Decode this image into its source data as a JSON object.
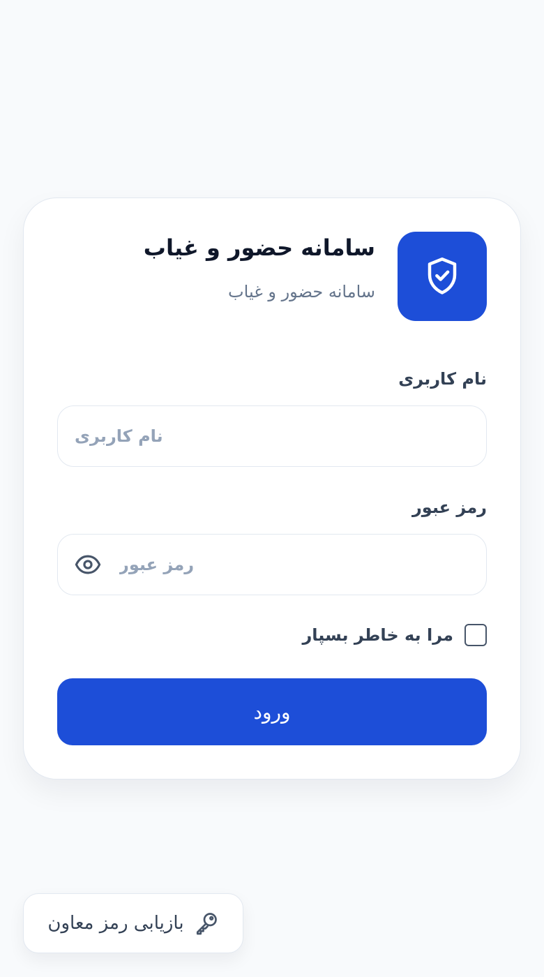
{
  "header": {
    "title": "سامانه حضور و غیاب",
    "subtitle": "سامانه حضور و غیاب",
    "logo_icon": "shield-check-icon",
    "accent_color": "#1d4ed8"
  },
  "form": {
    "username": {
      "label": "نام کاربری",
      "placeholder": "نام کاربری",
      "value": ""
    },
    "password": {
      "label": "رمز عبور",
      "placeholder": "رمز عبور",
      "value": "",
      "toggle_icon": "eye-icon"
    },
    "remember": {
      "label": "مرا به خاطر بسپار",
      "checked": false
    },
    "submit_label": "ورود"
  },
  "recover": {
    "label": "بازیابی رمز معاون",
    "icon": "key-icon"
  }
}
